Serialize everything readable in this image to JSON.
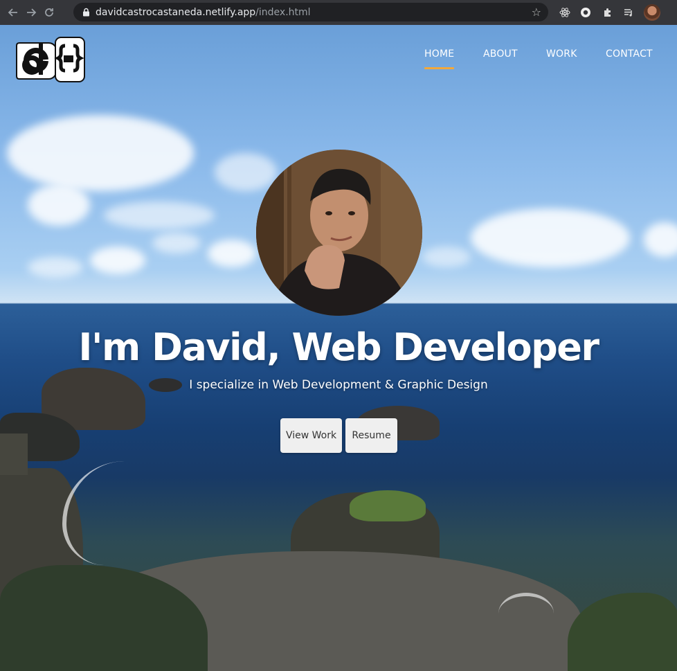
{
  "browser": {
    "url_host": "davidcastrocastaneda.netlify.app",
    "url_path": "/index.html"
  },
  "nav": {
    "items": [
      {
        "label": "HOME",
        "active": true
      },
      {
        "label": "ABOUT",
        "active": false
      },
      {
        "label": "WORK",
        "active": false
      },
      {
        "label": "CONTACT",
        "active": false
      }
    ]
  },
  "hero": {
    "title": "I'm David, Web Developer",
    "subtitle": "I specialize in Web Development & Graphic Design",
    "buttons": {
      "view_work": "View Work",
      "resume": "Resume"
    }
  },
  "colors": {
    "accent": "#f3a83a",
    "button_bg": "#efefef",
    "chrome_bg": "#35363a"
  },
  "icons": [
    "back-arrow-icon",
    "forward-arrow-icon",
    "reload-icon",
    "lock-icon",
    "bookmark-star-icon",
    "react-devtools-icon",
    "extension-icon",
    "puzzle-icon",
    "media-queue-icon",
    "profile-avatar"
  ]
}
